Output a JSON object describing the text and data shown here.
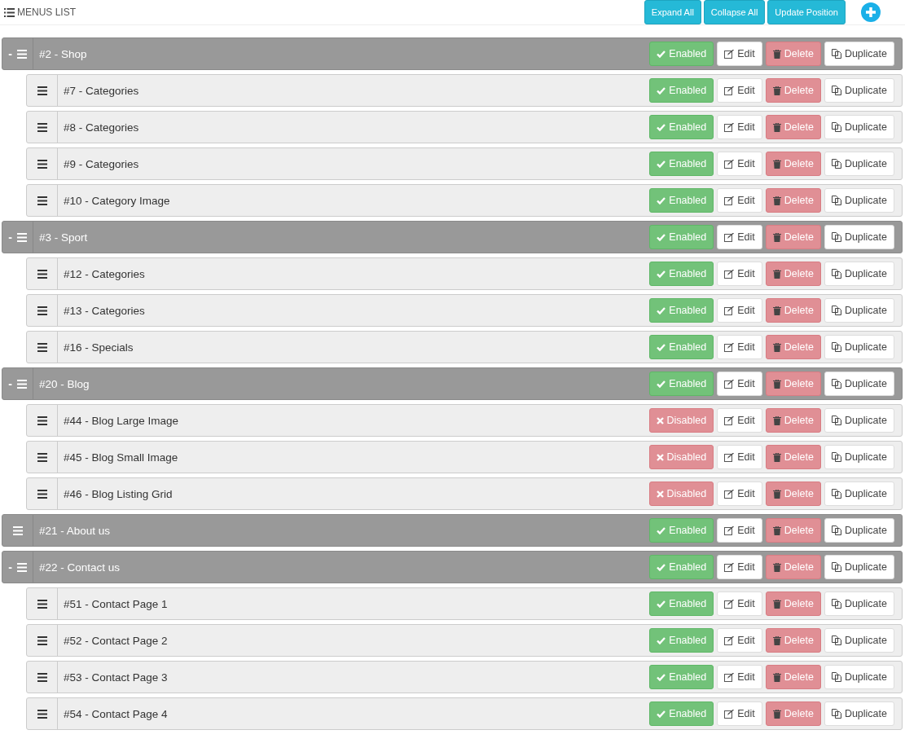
{
  "header": {
    "title": "MENUS LIST",
    "buttons": [
      "Expand All",
      "Collapse All",
      "Update Position"
    ]
  },
  "menus": [
    {
      "toggle": "-",
      "label": "#2 - Shop",
      "enabled": true,
      "status": "Enabled",
      "actions": [
        "Edit",
        "Delete",
        "Duplicate"
      ],
      "children": [
        {
          "label": "#7 - Categories",
          "enabled": true,
          "status": "Enabled",
          "actions": [
            "Edit",
            "Delete",
            "Duplicate"
          ]
        },
        {
          "label": "#8 - Categories",
          "enabled": true,
          "status": "Enabled",
          "actions": [
            "Edit",
            "Delete",
            "Duplicate"
          ]
        },
        {
          "label": "#9 - Categories",
          "enabled": true,
          "status": "Enabled",
          "actions": [
            "Edit",
            "Delete",
            "Duplicate"
          ]
        },
        {
          "label": "#10 - Category Image",
          "enabled": true,
          "status": "Enabled",
          "actions": [
            "Edit",
            "Delete",
            "Duplicate"
          ]
        }
      ]
    },
    {
      "toggle": "-",
      "label": "#3 - Sport",
      "enabled": true,
      "status": "Enabled",
      "actions": [
        "Edit",
        "Delete",
        "Duplicate"
      ],
      "children": [
        {
          "label": "#12 - Categories",
          "enabled": true,
          "status": "Enabled",
          "actions": [
            "Edit",
            "Delete",
            "Duplicate"
          ]
        },
        {
          "label": "#13 - Categories",
          "enabled": true,
          "status": "Enabled",
          "actions": [
            "Edit",
            "Delete",
            "Duplicate"
          ]
        },
        {
          "label": "#16 - Specials",
          "enabled": true,
          "status": "Enabled",
          "actions": [
            "Edit",
            "Delete",
            "Duplicate"
          ]
        }
      ]
    },
    {
      "toggle": "-",
      "label": "#20 - Blog",
      "enabled": true,
      "status": "Enabled",
      "actions": [
        "Edit",
        "Delete",
        "Duplicate"
      ],
      "children": [
        {
          "label": "#44 - Blog Large Image",
          "enabled": false,
          "status": "Disabled",
          "actions": [
            "Edit",
            "Delete",
            "Duplicate"
          ]
        },
        {
          "label": "#45 - Blog Small Image",
          "enabled": false,
          "status": "Disabled",
          "actions": [
            "Edit",
            "Delete",
            "Duplicate"
          ]
        },
        {
          "label": "#46 - Blog Listing Grid",
          "enabled": false,
          "status": "Disabled",
          "actions": [
            "Edit",
            "Delete",
            "Duplicate"
          ]
        }
      ]
    },
    {
      "label": "#21 - About us",
      "enabled": true,
      "status": "Enabled",
      "actions": [
        "Edit",
        "Delete",
        "Duplicate"
      ]
    },
    {
      "toggle": "-",
      "label": "#22 - Contact us",
      "enabled": true,
      "status": "Enabled",
      "actions": [
        "Edit",
        "Delete",
        "Duplicate"
      ],
      "children": [
        {
          "label": "#51 - Contact Page 1",
          "enabled": true,
          "status": "Enabled",
          "actions": [
            "Edit",
            "Delete",
            "Duplicate"
          ]
        },
        {
          "label": "#52 - Contact Page 2",
          "enabled": true,
          "status": "Enabled",
          "actions": [
            "Edit",
            "Delete",
            "Duplicate"
          ]
        },
        {
          "label": "#53 - Contact Page 3",
          "enabled": true,
          "status": "Enabled",
          "actions": [
            "Edit",
            "Delete",
            "Duplicate"
          ]
        },
        {
          "label": "#54 - Contact Page 4",
          "enabled": true,
          "status": "Enabled",
          "actions": [
            "Edit",
            "Delete",
            "Duplicate"
          ]
        }
      ]
    }
  ]
}
